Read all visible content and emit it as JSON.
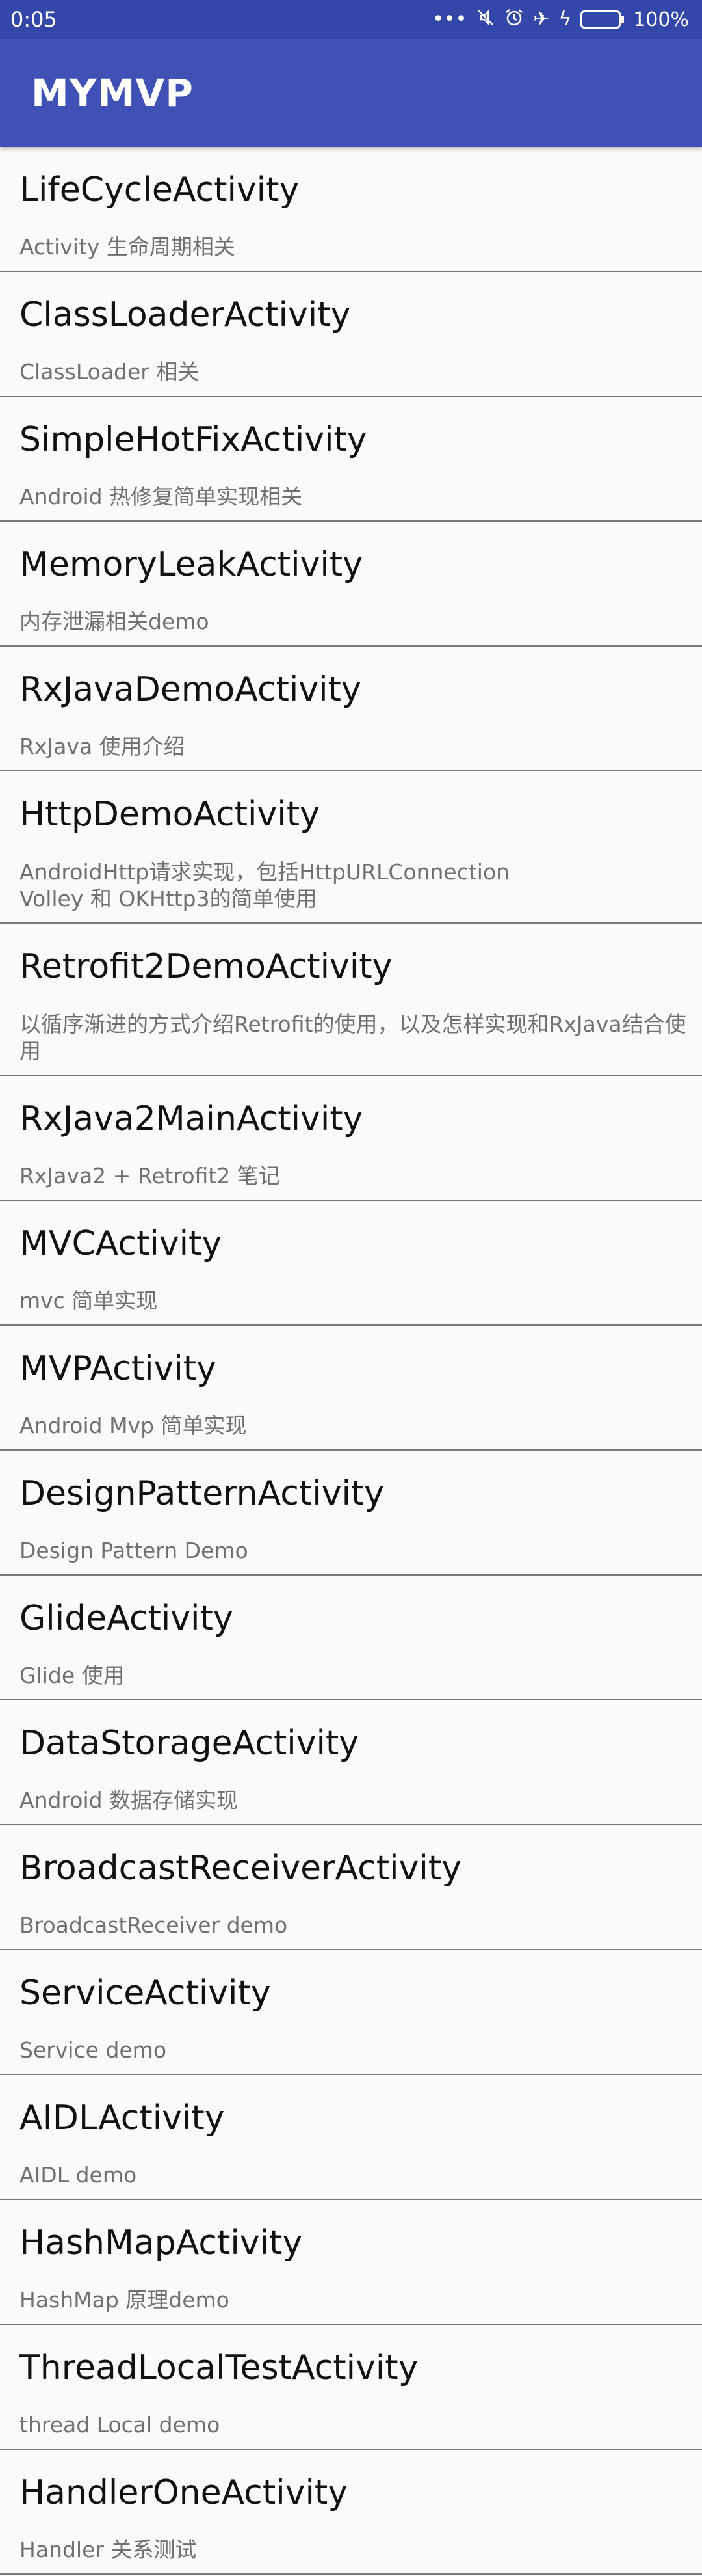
{
  "status_bar": {
    "time": "0:05",
    "battery_percent": "100%",
    "battery_level": 1.0,
    "icons": [
      "more-dots-icon",
      "mute-icon",
      "alarm-icon",
      "airplane-mode-icon",
      "charging-icon",
      "battery-icon"
    ]
  },
  "app_bar": {
    "title": "MYMVP",
    "background": "#3f51b5"
  },
  "list": {
    "items": [
      {
        "title": "LifeCycleActivity",
        "desc": "Activity 生命周期相关"
      },
      {
        "title": "ClassLoaderActivity",
        "desc": "ClassLoader 相关"
      },
      {
        "title": "SimpleHotFixActivity",
        "desc": "Android 热修复简单实现相关"
      },
      {
        "title": "MemoryLeakActivity",
        "desc": "内存泄漏相关demo"
      },
      {
        "title": "RxJavaDemoActivity",
        "desc": "RxJava 使用介绍"
      },
      {
        "title": "HttpDemoActivity",
        "desc": "AndroidHttp请求实现，包括HttpURLConnection\n Volley 和 OKHttp3的简单使用"
      },
      {
        "title": "Retrofit2DemoActivity",
        "desc": "以循序渐进的方式介绍Retrofit的使用，以及怎样实现和RxJava结合使用"
      },
      {
        "title": "RxJava2MainActivity",
        "desc": "RxJava2 + Retrofit2 笔记"
      },
      {
        "title": "MVCActivity",
        "desc": "mvc 简单实现"
      },
      {
        "title": "MVPActivity",
        "desc": "Android Mvp 简单实现"
      },
      {
        "title": "DesignPatternActivity",
        "desc": "Design Pattern Demo"
      },
      {
        "title": "GlideActivity",
        "desc": "Glide 使用"
      },
      {
        "title": "DataStorageActivity",
        "desc": "Android 数据存储实现"
      },
      {
        "title": "BroadcastReceiverActivity",
        "desc": "BroadcastReceiver demo"
      },
      {
        "title": "ServiceActivity",
        "desc": "Service demo"
      },
      {
        "title": "AIDLActivity",
        "desc": "AIDL demo"
      },
      {
        "title": "HashMapActivity",
        "desc": "HashMap 原理demo"
      },
      {
        "title": "ThreadLocalTestActivity",
        "desc": "thread Local demo"
      },
      {
        "title": "HandlerOneActivity",
        "desc": "Handler 关系测试"
      }
    ]
  }
}
